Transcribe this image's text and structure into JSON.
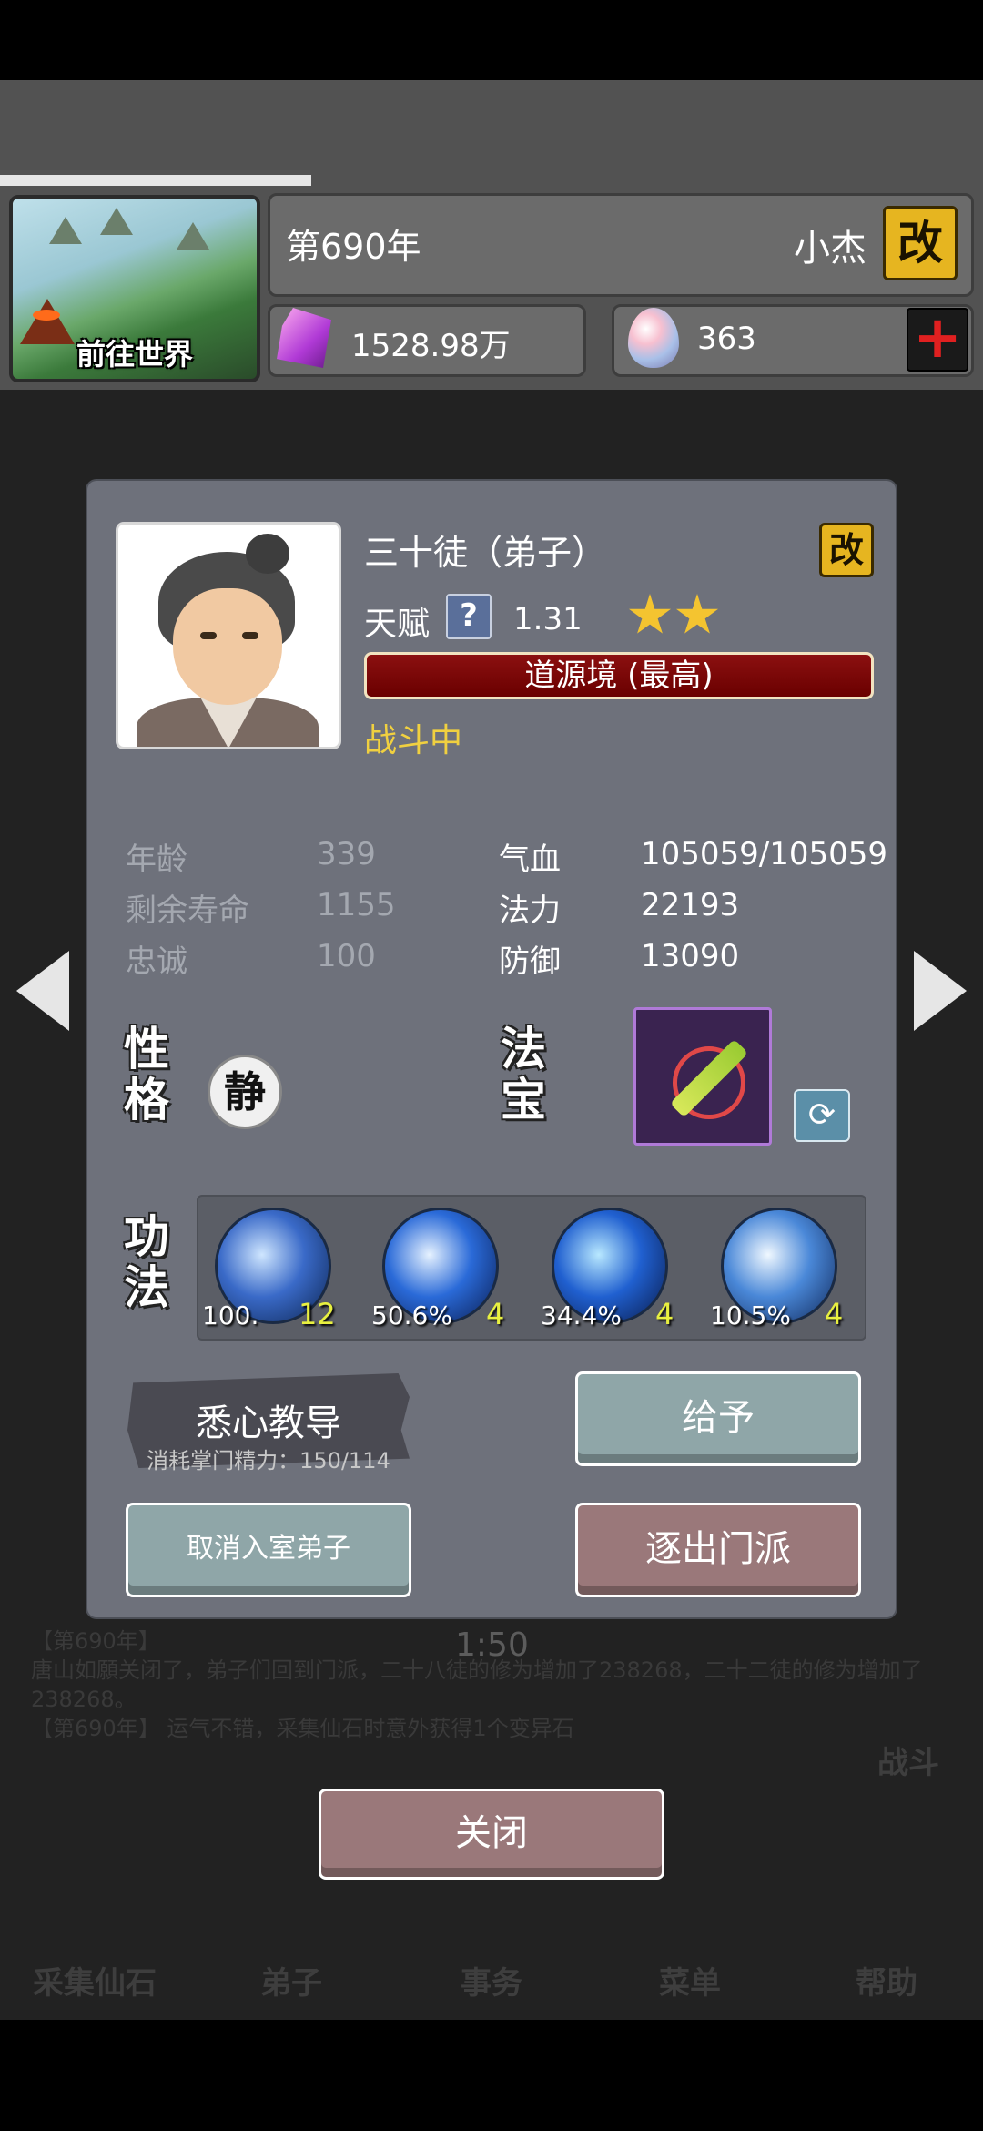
{
  "hud": {
    "world_label": "前往世界",
    "year": "第690年",
    "player_name": "小杰",
    "rename_label": "改",
    "spirit_stones": "1528.98万",
    "eggs": "363",
    "add_label": "+"
  },
  "background": {
    "timer": "1:50",
    "nav": [
      "采集仙石",
      "弟子",
      "事务",
      "菜单",
      "帮助"
    ],
    "battle_label": "战斗",
    "log": [
      "【第690年】",
      "唐山如願关闭了，弟子们回到门派，二十八徒的修为增加了238268，二十二徒的修为增加了238268。",
      "【第690年】 运气不错，采集仙石时意外获得1个变异石"
    ]
  },
  "dialog": {
    "name": "三十徒（弟子）",
    "rename_label": "改",
    "talent_label": "天赋",
    "help_label": "?",
    "talent_value": "1.31",
    "stars": 2,
    "realm": "道源境 (最高)",
    "status": "战斗中",
    "stats_left": [
      {
        "label": "年龄",
        "value": "339"
      },
      {
        "label": "剩余寿命",
        "value": "1155"
      },
      {
        "label": "忠诚",
        "value": "100"
      }
    ],
    "stats_right": [
      {
        "label": "气血",
        "value": "105059/105059"
      },
      {
        "label": "法力",
        "value": "22193"
      },
      {
        "label": "防御",
        "value": "13090"
      }
    ],
    "personality_title_1": "性",
    "personality_title_2": "格",
    "personality": "静",
    "treasure_title_1": "法",
    "treasure_title_2": "宝",
    "skills_title_1": "功",
    "skills_title_2": "法",
    "skills": [
      {
        "pct": "100.",
        "level": "12",
        "colors": [
          "#cfe6ff",
          "#3a6ac8",
          "#0c2450"
        ]
      },
      {
        "pct": "50.6%",
        "level": "4",
        "colors": [
          "#e6f2ff",
          "#2a6ad8",
          "#0a1c50"
        ]
      },
      {
        "pct": "34.4%",
        "level": "4",
        "colors": [
          "#b8e8ff",
          "#2060d0",
          "#0a1a48"
        ]
      },
      {
        "pct": "10.5%",
        "level": "4",
        "colors": [
          "#f0f8ff",
          "#4a88d8",
          "#10285a"
        ]
      }
    ],
    "teach_label": "悉心教导",
    "teach_cost": "消耗掌门精力：150/114",
    "give_label": "给予",
    "cancel_label": "取消入室弟子",
    "expel_label": "逐出门派"
  },
  "close_label": "关闭",
  "colors": {
    "gold": "#e6b520",
    "realm_red": "#8b1010",
    "status_yellow": "#f0d040",
    "level_yellow": "#e8f040"
  }
}
